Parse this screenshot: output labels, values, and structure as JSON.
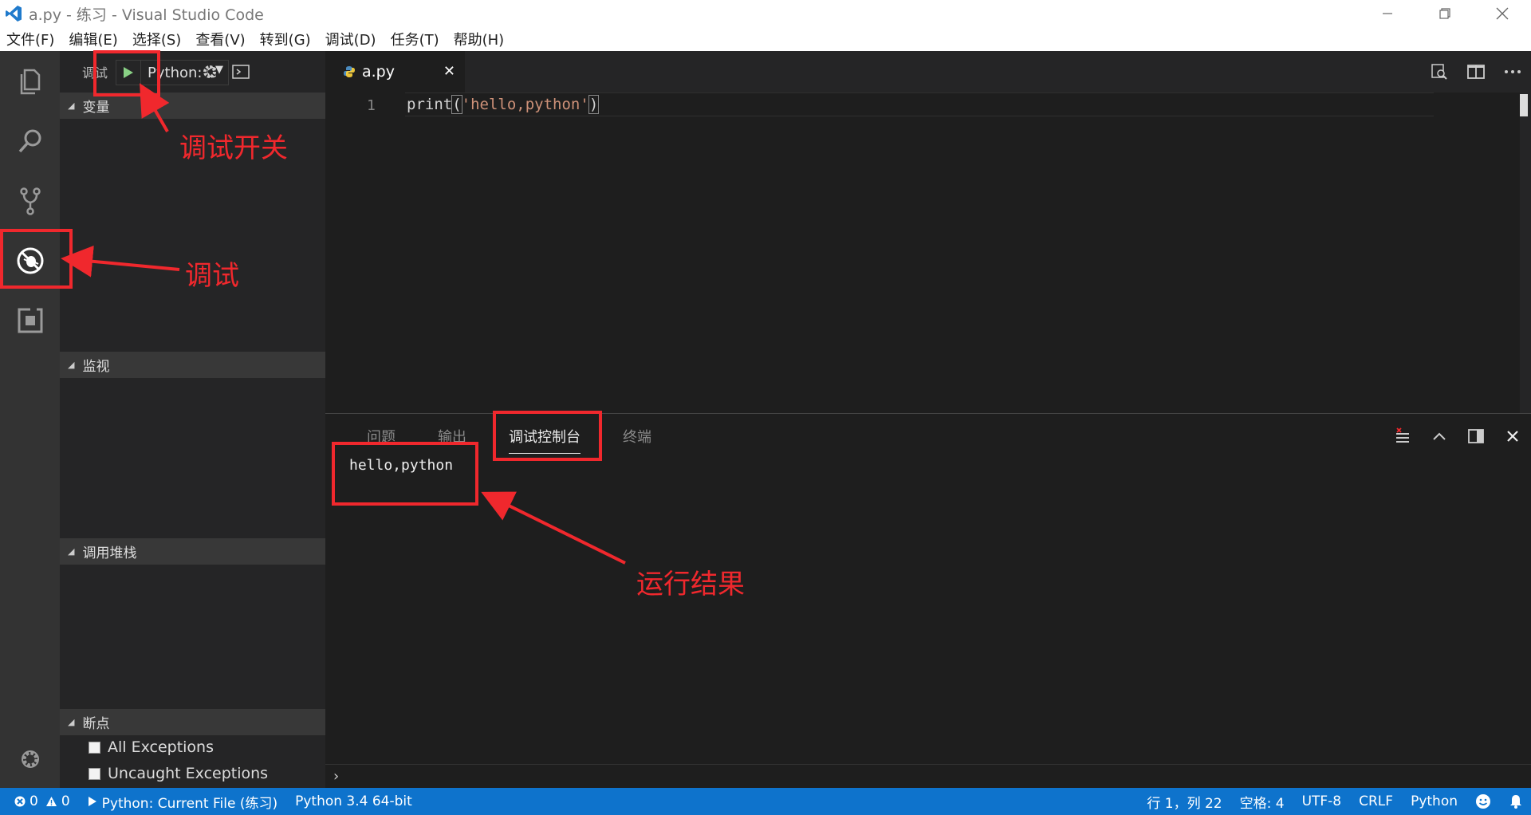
{
  "window": {
    "title": "a.py - 练习 - Visual Studio Code"
  },
  "menu": [
    "文件(F)",
    "编辑(E)",
    "选择(S)",
    "查看(V)",
    "转到(G)",
    "调试(D)",
    "任务(T)",
    "帮助(H)"
  ],
  "sidebar": {
    "header": "调试",
    "config_select": "Python: C",
    "sections": {
      "variables": "变量",
      "watch": "监视",
      "callstack": "调用堆栈",
      "breakpoints": "断点"
    },
    "breakpoints": [
      "All Exceptions",
      "Uncaught Exceptions"
    ]
  },
  "editor": {
    "tab_label": "a.py",
    "line_number": "1",
    "code": {
      "fn": "print",
      "open": "(",
      "arg": "'hello,python'",
      "close": ")"
    }
  },
  "panel": {
    "tabs": [
      "问题",
      "输出",
      "调试控制台",
      "终端"
    ],
    "active_tab": "调试控制台",
    "output": "hello,python",
    "repl_prompt": "›"
  },
  "status": {
    "errors": "0",
    "warnings": "0",
    "debug_config": "Python: Current File (练习)",
    "interpreter": "Python 3.4 64-bit",
    "cursor": "行 1，列 22",
    "indent": "空格: 4",
    "encoding": "UTF-8",
    "eol": "CRLF",
    "language": "Python"
  },
  "annotations": {
    "toggle": "调试开关",
    "debug": "调试",
    "result": "运行结果"
  },
  "colors": {
    "accent_red": "#f0282d",
    "statusbar": "#0e73cc",
    "play_green": "#89d185",
    "string": "#ce9178"
  }
}
